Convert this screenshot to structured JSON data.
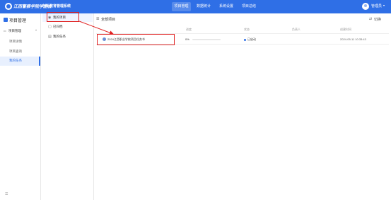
{
  "topbar": {
    "logo_text": "江西警察学院学生会",
    "logo_subtext": "创新教育管理系统",
    "nav": [
      "项目管理",
      "数据统计",
      "系统设置",
      "项目总结"
    ],
    "username": "管理员",
    "brand_color": "#2f6fe6"
  },
  "sidebar": {
    "title": "项目管理",
    "group": "项目管理",
    "items": [
      "项目详情",
      "项目查询",
      "我的任务"
    ],
    "active_index": 2,
    "collapse_icon": "menu-icon"
  },
  "subpanel": {
    "items": [
      {
        "label": "我的项目",
        "icon": "folder-icon"
      },
      {
        "label": "已归档",
        "icon": "archive-icon"
      },
      {
        "label": "我的任务",
        "icon": "task-icon"
      }
    ],
    "active_index": 0
  },
  "main": {
    "breadcrumb": "全部项目",
    "switch_label": "切换",
    "columns": {
      "name": "",
      "progress": "进度",
      "status": "状态",
      "owner": "负责人",
      "created": "创建时间"
    },
    "rows": [
      {
        "name": "2024江西职业学校项目任务书",
        "progress_text": "0%",
        "progress": 0,
        "status": "已启动",
        "owner": "",
        "created": "2024-05-11 10:33:43"
      }
    ]
  },
  "annotation_color": "#e02020"
}
